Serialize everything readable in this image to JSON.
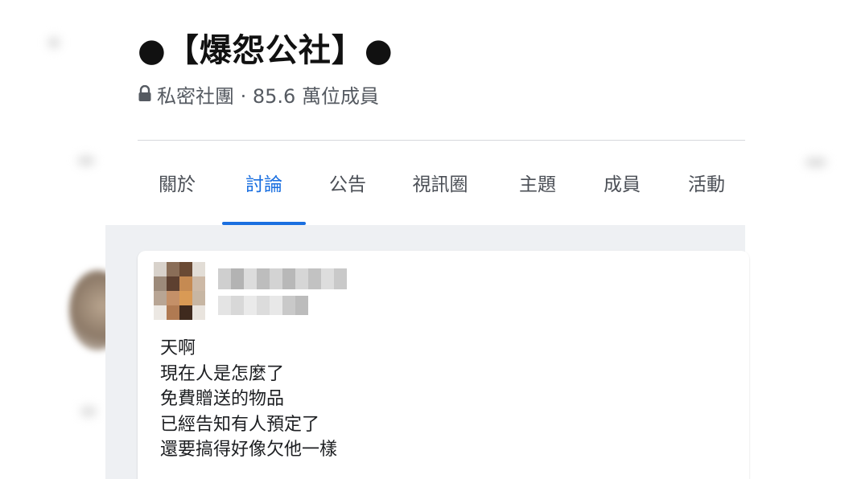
{
  "group": {
    "title": "●【爆怨公社】●",
    "meta": "私密社團 · 85.6 萬位成員",
    "lock_icon": "lock-icon"
  },
  "tabs": [
    {
      "label": "關於",
      "active": false
    },
    {
      "label": "討論",
      "active": true
    },
    {
      "label": "公告",
      "active": false
    },
    {
      "label": "視訊圈",
      "active": false
    },
    {
      "label": "主題",
      "active": false
    },
    {
      "label": "成員",
      "active": false
    },
    {
      "label": "活動",
      "active": false
    }
  ],
  "post": {
    "author_avatar": "blurred-avatar",
    "lines": [
      "天啊",
      "現在人是怎麼了",
      "免費贈送的物品",
      "已經告知有人預定了",
      "還要搞得好像欠他一樣"
    ]
  },
  "colors": {
    "accent": "#1a6fe0",
    "feed_background": "#eef0f3",
    "text_primary": "#1c1e21",
    "text_secondary": "#555a61"
  }
}
